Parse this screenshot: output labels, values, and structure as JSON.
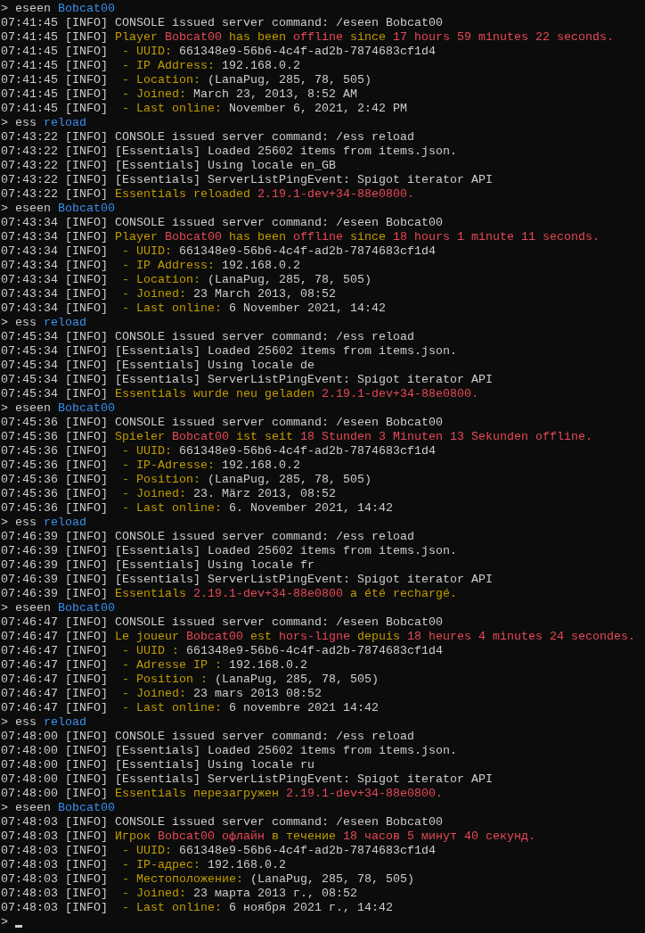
{
  "lines": [
    {
      "segments": [
        {
          "text": "> eseen ",
          "color": "#cccccc"
        },
        {
          "text": "Bobcat00",
          "color": "#3b8eea"
        }
      ]
    },
    {
      "segments": [
        {
          "text": "07:41:45 [INFO] CONSOLE issued server command: /eseen Bobcat00",
          "color": "#cccccc"
        }
      ]
    },
    {
      "segments": [
        {
          "text": "07:41:45 [INFO] ",
          "color": "#cccccc"
        },
        {
          "text": "Player ",
          "color": "#c19c00"
        },
        {
          "text": "Bobcat00",
          "color": "#e74856"
        },
        {
          "text": " has been ",
          "color": "#c19c00"
        },
        {
          "text": "offline",
          "color": "#e74856"
        },
        {
          "text": " since ",
          "color": "#c19c00"
        },
        {
          "text": "17 hours 59 minutes 22 seconds.",
          "color": "#e74856"
        }
      ]
    },
    {
      "segments": [
        {
          "text": "07:41:45 [INFO] ",
          "color": "#cccccc"
        },
        {
          "text": " - UUID: ",
          "color": "#c19c00"
        },
        {
          "text": "661348e9-56b6-4c4f-ad2b-7874683cf1d4",
          "color": "#cccccc"
        }
      ]
    },
    {
      "segments": [
        {
          "text": "07:41:45 [INFO] ",
          "color": "#cccccc"
        },
        {
          "text": " - IP Address: ",
          "color": "#c19c00"
        },
        {
          "text": "192.168.0.2",
          "color": "#cccccc"
        }
      ]
    },
    {
      "segments": [
        {
          "text": "07:41:45 [INFO] ",
          "color": "#cccccc"
        },
        {
          "text": " - Location: ",
          "color": "#c19c00"
        },
        {
          "text": "(LanaPug, 285, 78, 505)",
          "color": "#cccccc"
        }
      ]
    },
    {
      "segments": [
        {
          "text": "07:41:45 [INFO] ",
          "color": "#cccccc"
        },
        {
          "text": " - Joined: ",
          "color": "#c19c00"
        },
        {
          "text": "March 23, 2013, 8:52 AM",
          "color": "#cccccc"
        }
      ]
    },
    {
      "segments": [
        {
          "text": "07:41:45 [INFO] ",
          "color": "#cccccc"
        },
        {
          "text": " - Last online: ",
          "color": "#c19c00"
        },
        {
          "text": "November 6, 2021, 2:42 PM",
          "color": "#cccccc"
        }
      ]
    },
    {
      "segments": [
        {
          "text": "> ess ",
          "color": "#cccccc"
        },
        {
          "text": "reload",
          "color": "#3b8eea"
        }
      ]
    },
    {
      "segments": [
        {
          "text": "07:43:22 [INFO] CONSOLE issued server command: /ess reload",
          "color": "#cccccc"
        }
      ]
    },
    {
      "segments": [
        {
          "text": "07:43:22 [INFO] [Essentials] Loaded 25602 items from items.json.",
          "color": "#cccccc"
        }
      ]
    },
    {
      "segments": [
        {
          "text": "07:43:22 [INFO] [Essentials] Using locale en_GB",
          "color": "#cccccc"
        }
      ]
    },
    {
      "segments": [
        {
          "text": "07:43:22 [INFO] [Essentials] ServerListPingEvent: Spigot iterator API",
          "color": "#cccccc"
        }
      ]
    },
    {
      "segments": [
        {
          "text": "07:43:22 [INFO] ",
          "color": "#cccccc"
        },
        {
          "text": "Essentials reloaded ",
          "color": "#c19c00"
        },
        {
          "text": "2.19.1-dev+34-88e0800.",
          "color": "#e74856"
        }
      ]
    },
    {
      "segments": [
        {
          "text": "> eseen ",
          "color": "#cccccc"
        },
        {
          "text": "Bobcat00",
          "color": "#3b8eea"
        }
      ]
    },
    {
      "segments": [
        {
          "text": "07:43:34 [INFO] CONSOLE issued server command: /eseen Bobcat00",
          "color": "#cccccc"
        }
      ]
    },
    {
      "segments": [
        {
          "text": "07:43:34 [INFO] ",
          "color": "#cccccc"
        },
        {
          "text": "Player ",
          "color": "#c19c00"
        },
        {
          "text": "Bobcat00",
          "color": "#e74856"
        },
        {
          "text": " has been ",
          "color": "#c19c00"
        },
        {
          "text": "offline",
          "color": "#e74856"
        },
        {
          "text": " since ",
          "color": "#c19c00"
        },
        {
          "text": "18 hours 1 minute 11 seconds.",
          "color": "#e74856"
        }
      ]
    },
    {
      "segments": [
        {
          "text": "07:43:34 [INFO] ",
          "color": "#cccccc"
        },
        {
          "text": " - UUID: ",
          "color": "#c19c00"
        },
        {
          "text": "661348e9-56b6-4c4f-ad2b-7874683cf1d4",
          "color": "#cccccc"
        }
      ]
    },
    {
      "segments": [
        {
          "text": "07:43:34 [INFO] ",
          "color": "#cccccc"
        },
        {
          "text": " - IP Address: ",
          "color": "#c19c00"
        },
        {
          "text": "192.168.0.2",
          "color": "#cccccc"
        }
      ]
    },
    {
      "segments": [
        {
          "text": "07:43:34 [INFO] ",
          "color": "#cccccc"
        },
        {
          "text": " - Location: ",
          "color": "#c19c00"
        },
        {
          "text": "(LanaPug, 285, 78, 505)",
          "color": "#cccccc"
        }
      ]
    },
    {
      "segments": [
        {
          "text": "07:43:34 [INFO] ",
          "color": "#cccccc"
        },
        {
          "text": " - Joined: ",
          "color": "#c19c00"
        },
        {
          "text": "23 March 2013, 08:52",
          "color": "#cccccc"
        }
      ]
    },
    {
      "segments": [
        {
          "text": "07:43:34 [INFO] ",
          "color": "#cccccc"
        },
        {
          "text": " - Last online: ",
          "color": "#c19c00"
        },
        {
          "text": "6 November 2021, 14:42",
          "color": "#cccccc"
        }
      ]
    },
    {
      "segments": [
        {
          "text": "> ess ",
          "color": "#cccccc"
        },
        {
          "text": "reload",
          "color": "#3b8eea"
        }
      ]
    },
    {
      "segments": [
        {
          "text": "07:45:34 [INFO] CONSOLE issued server command: /ess reload",
          "color": "#cccccc"
        }
      ]
    },
    {
      "segments": [
        {
          "text": "07:45:34 [INFO] [Essentials] Loaded 25602 items from items.json.",
          "color": "#cccccc"
        }
      ]
    },
    {
      "segments": [
        {
          "text": "07:45:34 [INFO] [Essentials] Using locale de",
          "color": "#cccccc"
        }
      ]
    },
    {
      "segments": [
        {
          "text": "07:45:34 [INFO] [Essentials] ServerListPingEvent: Spigot iterator API",
          "color": "#cccccc"
        }
      ]
    },
    {
      "segments": [
        {
          "text": "07:45:34 [INFO] ",
          "color": "#cccccc"
        },
        {
          "text": "Essentials wurde neu geladen ",
          "color": "#c19c00"
        },
        {
          "text": "2.19.1-dev+34-88e0800.",
          "color": "#e74856"
        }
      ]
    },
    {
      "segments": [
        {
          "text": "> eseen ",
          "color": "#cccccc"
        },
        {
          "text": "Bobcat00",
          "color": "#3b8eea"
        }
      ]
    },
    {
      "segments": [
        {
          "text": "07:45:36 [INFO] CONSOLE issued server command: /eseen Bobcat00",
          "color": "#cccccc"
        }
      ]
    },
    {
      "segments": [
        {
          "text": "07:45:36 [INFO] ",
          "color": "#cccccc"
        },
        {
          "text": "Spieler ",
          "color": "#c19c00"
        },
        {
          "text": "Bobcat00",
          "color": "#e74856"
        },
        {
          "text": " ist seit ",
          "color": "#c19c00"
        },
        {
          "text": "18 Stunden 3 Minuten 13 Sekunden offline.",
          "color": "#e74856"
        }
      ]
    },
    {
      "segments": [
        {
          "text": "07:45:36 [INFO] ",
          "color": "#cccccc"
        },
        {
          "text": " - UUID: ",
          "color": "#c19c00"
        },
        {
          "text": "661348e9-56b6-4c4f-ad2b-7874683cf1d4",
          "color": "#cccccc"
        }
      ]
    },
    {
      "segments": [
        {
          "text": "07:45:36 [INFO] ",
          "color": "#cccccc"
        },
        {
          "text": " - IP-Adresse: ",
          "color": "#c19c00"
        },
        {
          "text": "192.168.0.2",
          "color": "#cccccc"
        }
      ]
    },
    {
      "segments": [
        {
          "text": "07:45:36 [INFO] ",
          "color": "#cccccc"
        },
        {
          "text": " - Position: ",
          "color": "#c19c00"
        },
        {
          "text": "(LanaPug, 285, 78, 505)",
          "color": "#cccccc"
        }
      ]
    },
    {
      "segments": [
        {
          "text": "07:45:36 [INFO] ",
          "color": "#cccccc"
        },
        {
          "text": " - Joined: ",
          "color": "#c19c00"
        },
        {
          "text": "23. März 2013, 08:52",
          "color": "#cccccc"
        }
      ]
    },
    {
      "segments": [
        {
          "text": "07:45:36 [INFO] ",
          "color": "#cccccc"
        },
        {
          "text": " - Last online: ",
          "color": "#c19c00"
        },
        {
          "text": "6. November 2021, 14:42",
          "color": "#cccccc"
        }
      ]
    },
    {
      "segments": [
        {
          "text": "> ess ",
          "color": "#cccccc"
        },
        {
          "text": "reload",
          "color": "#3b8eea"
        }
      ]
    },
    {
      "segments": [
        {
          "text": "07:46:39 [INFO] CONSOLE issued server command: /ess reload",
          "color": "#cccccc"
        }
      ]
    },
    {
      "segments": [
        {
          "text": "07:46:39 [INFO] [Essentials] Loaded 25602 items from items.json.",
          "color": "#cccccc"
        }
      ]
    },
    {
      "segments": [
        {
          "text": "07:46:39 [INFO] [Essentials] Using locale fr",
          "color": "#cccccc"
        }
      ]
    },
    {
      "segments": [
        {
          "text": "07:46:39 [INFO] [Essentials] ServerListPingEvent: Spigot iterator API",
          "color": "#cccccc"
        }
      ]
    },
    {
      "segments": [
        {
          "text": "07:46:39 [INFO] ",
          "color": "#cccccc"
        },
        {
          "text": "Essentials ",
          "color": "#c19c00"
        },
        {
          "text": "2.19.1-dev+34-88e0800",
          "color": "#e74856"
        },
        {
          "text": " a été rechargé.",
          "color": "#c19c00"
        }
      ]
    },
    {
      "segments": [
        {
          "text": "> eseen ",
          "color": "#cccccc"
        },
        {
          "text": "Bobcat00",
          "color": "#3b8eea"
        }
      ]
    },
    {
      "segments": [
        {
          "text": "07:46:47 [INFO] CONSOLE issued server command: /eseen Bobcat00",
          "color": "#cccccc"
        }
      ]
    },
    {
      "segments": [
        {
          "text": "07:46:47 [INFO] ",
          "color": "#cccccc"
        },
        {
          "text": "Le joueur ",
          "color": "#c19c00"
        },
        {
          "text": "Bobcat00",
          "color": "#e74856"
        },
        {
          "text": " est ",
          "color": "#c19c00"
        },
        {
          "text": "hors-ligne",
          "color": "#e74856"
        },
        {
          "text": " depuis ",
          "color": "#c19c00"
        },
        {
          "text": "18 heures 4 minutes 24 secondes.",
          "color": "#e74856"
        }
      ]
    },
    {
      "segments": [
        {
          "text": "07:46:47 [INFO] ",
          "color": "#cccccc"
        },
        {
          "text": " - UUID : ",
          "color": "#c19c00"
        },
        {
          "text": "661348e9-56b6-4c4f-ad2b-7874683cf1d4",
          "color": "#cccccc"
        }
      ]
    },
    {
      "segments": [
        {
          "text": "07:46:47 [INFO] ",
          "color": "#cccccc"
        },
        {
          "text": " - Adresse IP : ",
          "color": "#c19c00"
        },
        {
          "text": "192.168.0.2",
          "color": "#cccccc"
        }
      ]
    },
    {
      "segments": [
        {
          "text": "07:46:47 [INFO] ",
          "color": "#cccccc"
        },
        {
          "text": " - Position : ",
          "color": "#c19c00"
        },
        {
          "text": "(LanaPug, 285, 78, 505)",
          "color": "#cccccc"
        }
      ]
    },
    {
      "segments": [
        {
          "text": "07:46:47 [INFO] ",
          "color": "#cccccc"
        },
        {
          "text": " - Joined: ",
          "color": "#c19c00"
        },
        {
          "text": "23 mars 2013 08:52",
          "color": "#cccccc"
        }
      ]
    },
    {
      "segments": [
        {
          "text": "07:46:47 [INFO] ",
          "color": "#cccccc"
        },
        {
          "text": " - Last online: ",
          "color": "#c19c00"
        },
        {
          "text": "6 novembre 2021 14:42",
          "color": "#cccccc"
        }
      ]
    },
    {
      "segments": [
        {
          "text": "> ess ",
          "color": "#cccccc"
        },
        {
          "text": "reload",
          "color": "#3b8eea"
        }
      ]
    },
    {
      "segments": [
        {
          "text": "07:48:00 [INFO] CONSOLE issued server command: /ess reload",
          "color": "#cccccc"
        }
      ]
    },
    {
      "segments": [
        {
          "text": "07:48:00 [INFO] [Essentials] Loaded 25602 items from items.json.",
          "color": "#cccccc"
        }
      ]
    },
    {
      "segments": [
        {
          "text": "07:48:00 [INFO] [Essentials] Using locale ru",
          "color": "#cccccc"
        }
      ]
    },
    {
      "segments": [
        {
          "text": "07:48:00 [INFO] [Essentials] ServerListPingEvent: Spigot iterator API",
          "color": "#cccccc"
        }
      ]
    },
    {
      "segments": [
        {
          "text": "07:48:00 [INFO] ",
          "color": "#cccccc"
        },
        {
          "text": "Essentials перезагружен ",
          "color": "#c19c00"
        },
        {
          "text": "2.19.1-dev+34-88e0800.",
          "color": "#e74856"
        }
      ]
    },
    {
      "segments": [
        {
          "text": "> eseen ",
          "color": "#cccccc"
        },
        {
          "text": "Bobcat00",
          "color": "#3b8eea"
        }
      ]
    },
    {
      "segments": [
        {
          "text": "07:48:03 [INFO] CONSOLE issued server command: /eseen Bobcat00",
          "color": "#cccccc"
        }
      ]
    },
    {
      "segments": [
        {
          "text": "07:48:03 [INFO] ",
          "color": "#cccccc"
        },
        {
          "text": "Игрок ",
          "color": "#c19c00"
        },
        {
          "text": "Bobcat00 офлайн",
          "color": "#e74856"
        },
        {
          "text": " в течение ",
          "color": "#c19c00"
        },
        {
          "text": "18 часов 5 минут 40 секунд.",
          "color": "#e74856"
        }
      ]
    },
    {
      "segments": [
        {
          "text": "07:48:03 [INFO] ",
          "color": "#cccccc"
        },
        {
          "text": " - UUID: ",
          "color": "#c19c00"
        },
        {
          "text": "661348e9-56b6-4c4f-ad2b-7874683cf1d4",
          "color": "#cccccc"
        }
      ]
    },
    {
      "segments": [
        {
          "text": "07:48:03 [INFO] ",
          "color": "#cccccc"
        },
        {
          "text": " - IP-адрес: ",
          "color": "#c19c00"
        },
        {
          "text": "192.168.0.2",
          "color": "#cccccc"
        }
      ]
    },
    {
      "segments": [
        {
          "text": "07:48:03 [INFO] ",
          "color": "#cccccc"
        },
        {
          "text": " - Местоположение: ",
          "color": "#c19c00"
        },
        {
          "text": "(LanaPug, 285, 78, 505)",
          "color": "#cccccc"
        }
      ]
    },
    {
      "segments": [
        {
          "text": "07:48:03 [INFO] ",
          "color": "#cccccc"
        },
        {
          "text": " - Joined: ",
          "color": "#c19c00"
        },
        {
          "text": "23 марта 2013 г., 08:52",
          "color": "#cccccc"
        }
      ]
    },
    {
      "segments": [
        {
          "text": "07:48:03 [INFO] ",
          "color": "#cccccc"
        },
        {
          "text": " - Last online: ",
          "color": "#c19c00"
        },
        {
          "text": "6 ноября 2021 г., 14:42",
          "color": "#cccccc"
        }
      ]
    }
  ],
  "prompt": {
    "text": ">"
  }
}
